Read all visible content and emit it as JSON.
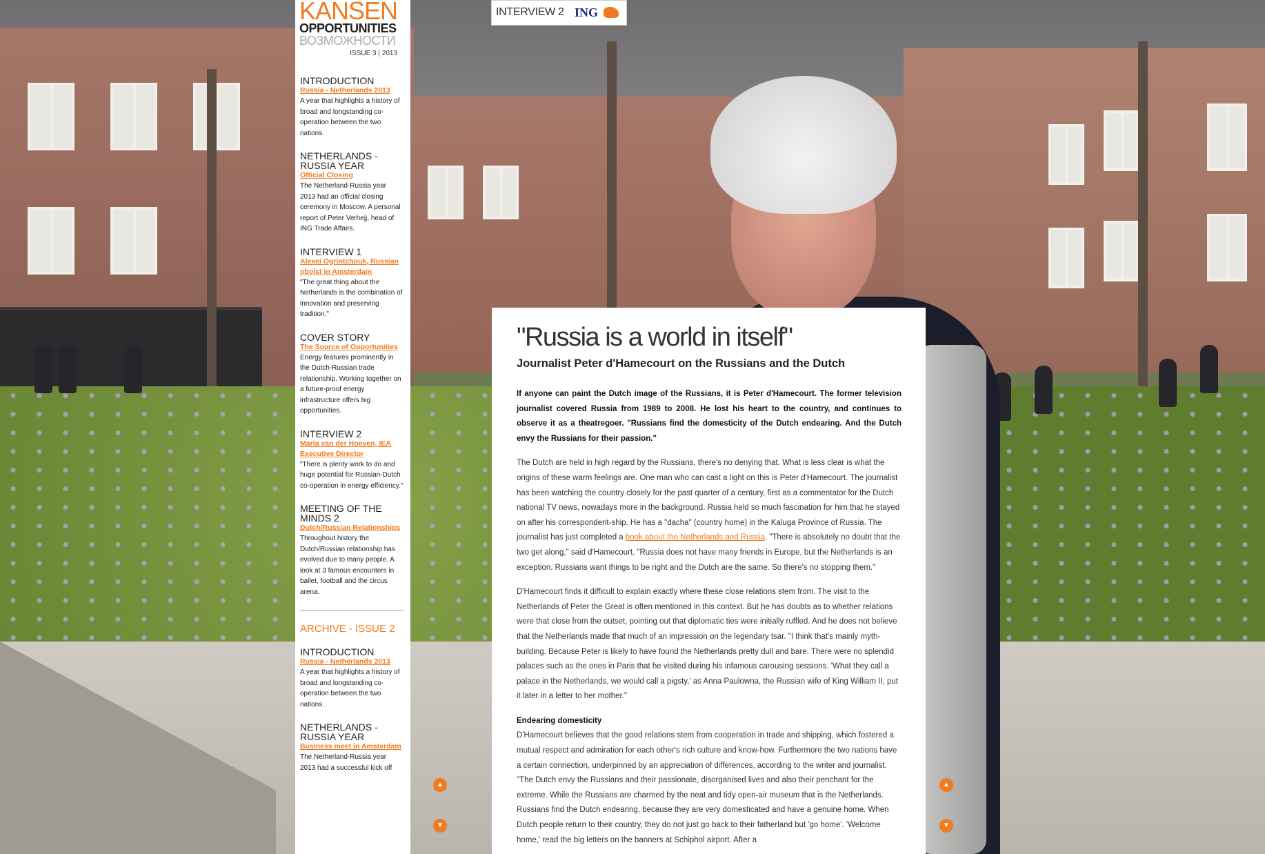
{
  "logo": {
    "line1": "KANSEN",
    "line2": "OPPORTUNITIES",
    "line3": "ВОЗМОЖНОСТИ"
  },
  "issue": "ISSUE 3 | 2013",
  "topbar": {
    "label": "INTERVIEW 2",
    "brand": "ING"
  },
  "sidebar": {
    "sections": [
      {
        "heading": "INTRODUCTION",
        "link": "Russia - Netherlands 2013",
        "text": "A year that highlights a history of broad and longstanding co-operation between the two nations."
      },
      {
        "heading": "NETHERLANDS - RUSSIA YEAR",
        "link": "Official Closing",
        "text": "The Netherland-Russia year 2013 had an official closing ceremony in Moscow. A personal report of Peter Verhejj, head of ING Trade Affairs."
      },
      {
        "heading": "INTERVIEW 1",
        "link": "Alexei Ogrintchouk, Russian oboist in Amsterdam",
        "text": "\"The great thing about the Netherlands is the combination of innovation and preserving tradition.\""
      },
      {
        "heading": "COVER STORY",
        "link": "The Source of Opportunities",
        "text": "Energy features prominently in the Dutch-Russian trade relationship. Working together on a future-proof energy infrastructure offers big opportunities."
      },
      {
        "heading": "INTERVIEW 2",
        "link": "Maria van der Hoeven, IEA Executive Director",
        "text": "\"There is plenty work to do and huge potential for Russian-Dutch co-operation in energy efficiency.\""
      },
      {
        "heading": "MEETING OF THE MINDS 2",
        "link": "Dutch/Russian Relationships",
        "text": "Throughout history the Dutch/Russian relationship has evolved due to many people. A look at 3 famous encounters in ballet, football and the circus arena."
      }
    ],
    "archive_label": "ARCHIVE - ISSUE 2",
    "archive_sections": [
      {
        "heading": "INTRODUCTION",
        "link": "Russia - Netherlands 2013",
        "text": "A year that highlights a history of broad and longstanding co-operation between the two nations."
      },
      {
        "heading": "NETHERLANDS - RUSSIA YEAR",
        "link": "Business meet in Amsterdam",
        "text": "The Netherland-Russia year 2013 had a successful kick off"
      }
    ]
  },
  "article": {
    "title": "\"Russia is a world in itself\"",
    "subtitle": "Journalist Peter d'Hamecourt on the Russians and the Dutch",
    "lead": "If anyone can paint the Dutch image of the Russians, it is Peter d'Hamecourt. The former television journalist covered Russia from 1989 to 2008. He lost his heart to the country, and continues to observe it as a theatregoer. \"Russians find the domesticity of the Dutch endearing. And the Dutch envy the Russians for their passion.\"",
    "p1_before": "The Dutch are held in high regard by the Russians, there's no denying that. What is less clear is what the origins of these warm feelings are. One man who can cast a light on this is Peter d'Hamecourt. The journalist has been watching the country closely for the past quarter of a century, first as a commentator for the Dutch national TV news, nowadays more in the background. Russia held so much fascination for him that he stayed on after his correspondent-ship. He has a \"dacha\" (country home) in the Kaluga Province of Russia. The journalist has just completed a ",
    "p1_link": "book about the Netherlands and Russia",
    "p1_after": ". \"There is absolutely no doubt that the two get along,\" said d'Hamecourt. \"Russia does not have many friends in Europe, but the Netherlands is an exception. Russians want things to be right and the Dutch are the same. So there's no stopping them.\"",
    "p2": "D'Hamecourt finds it difficult to explain exactly where these close relations stem from. The visit to the Netherlands of Peter the Great is often mentioned in this context. But he has doubts as to whether relations were that close from the outset, pointing out that diplomatic ties were initially ruffled. And he does not believe that the Netherlands made that much of an impression on the legendary tsar. \"I think that's mainly myth-building. Because Peter is likely to have found the Netherlands pretty dull and bare. There were no splendid palaces such as the ones in Paris that he visited during his infamous carousing sessions. 'What they call a palace in the Netherlands, we would call a pigsty,' as Anna Paulowna, the Russian wife of King William II, put it later in a letter to her mother.\"",
    "subhead": "Endearing domesticity",
    "p3": "D'Hamecourt believes that the good relations stem from cooperation in trade and shipping, which fostered a mutual respect and admiration for each other's rich culture and know-how. Furthermore the two nations have a certain connection, underpinned by an appreciation of differences, according to the writer and journalist. \"The Dutch envy the Russians and their passionate, disorganised lives and also their penchant for the extreme. While the Russians are charmed by the neat and tidy open-air museum that is the Netherlands. Russians find the Dutch endearing, because they are very domesticated and have a genuine home. When Dutch people return to their country, they do not just go back to their fatherland but 'go home'. 'Welcome home,' read the big letters on the banners at Schiphol airport. After a"
  },
  "colors": {
    "accent": "#f07a20",
    "ing_blue": "#1b2c7a"
  },
  "icons": {
    "up": "▲",
    "down": "▼"
  }
}
